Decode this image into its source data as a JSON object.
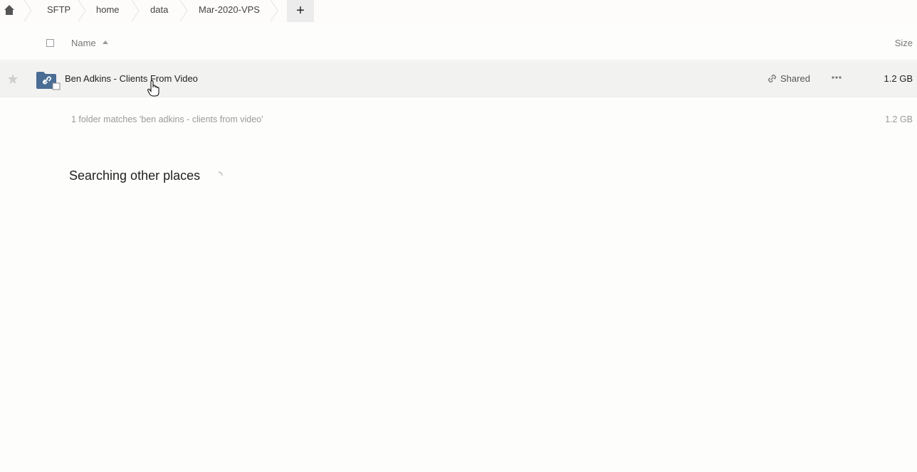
{
  "breadcrumb": {
    "home_icon": "home-icon",
    "items": [
      "SFTP",
      "home",
      "data",
      "Mar-2020-VPS"
    ],
    "add_label": "+"
  },
  "header": {
    "name_label": "Name",
    "sort": "ascending",
    "size_label": "Size"
  },
  "files": [
    {
      "name": "Ben Adkins - Clients From Video",
      "type": "shared-folder",
      "share_label": "Shared",
      "size": "1.2 GB",
      "favorite": false
    }
  ],
  "summary": {
    "text": "1 folder matches 'ben adkins - clients from video'",
    "size": "1.2 GB"
  },
  "search_other": {
    "label": "Searching other places"
  },
  "colors": {
    "folder": "#4a6d94",
    "accent_gray": "#ececec",
    "muted_text": "#9a9a9a"
  }
}
